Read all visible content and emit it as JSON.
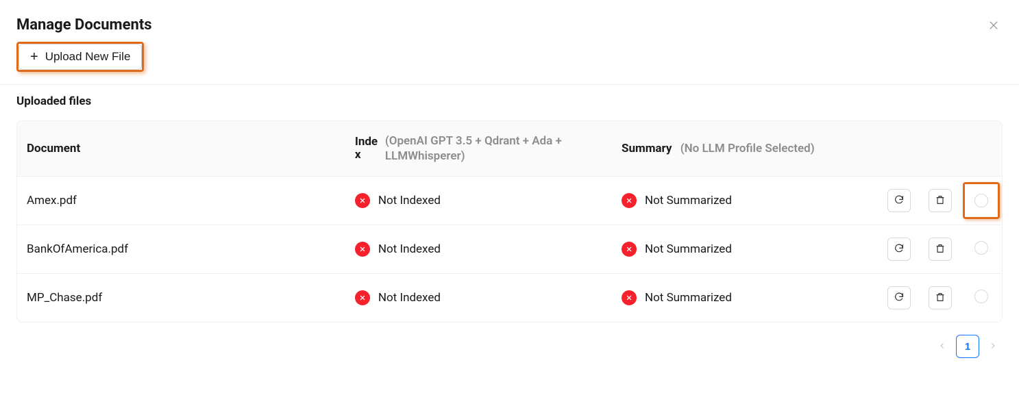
{
  "title": "Manage Documents",
  "upload_button_label": "Upload New File",
  "section_title": "Uploaded files",
  "columns": {
    "document": "Document",
    "index_main": "Index",
    "index_sub": "(OpenAI GPT 3.5 + Qdrant + Ada + LLMWhisperer)",
    "summary_main": "Summary",
    "summary_sub": "(No LLM Profile Selected)"
  },
  "status_labels": {
    "not_indexed": "Not Indexed",
    "not_summarized": "Not Summarized"
  },
  "rows": [
    {
      "name": "Amex.pdf",
      "index_status": "not_indexed",
      "summary_status": "not_summarized",
      "highlight_radio": true
    },
    {
      "name": "BankOfAmerica.pdf",
      "index_status": "not_indexed",
      "summary_status": "not_summarized",
      "highlight_radio": false
    },
    {
      "name": "MP_Chase.pdf",
      "index_status": "not_indexed",
      "summary_status": "not_summarized",
      "highlight_radio": false
    }
  ],
  "pagination": {
    "current": "1"
  }
}
